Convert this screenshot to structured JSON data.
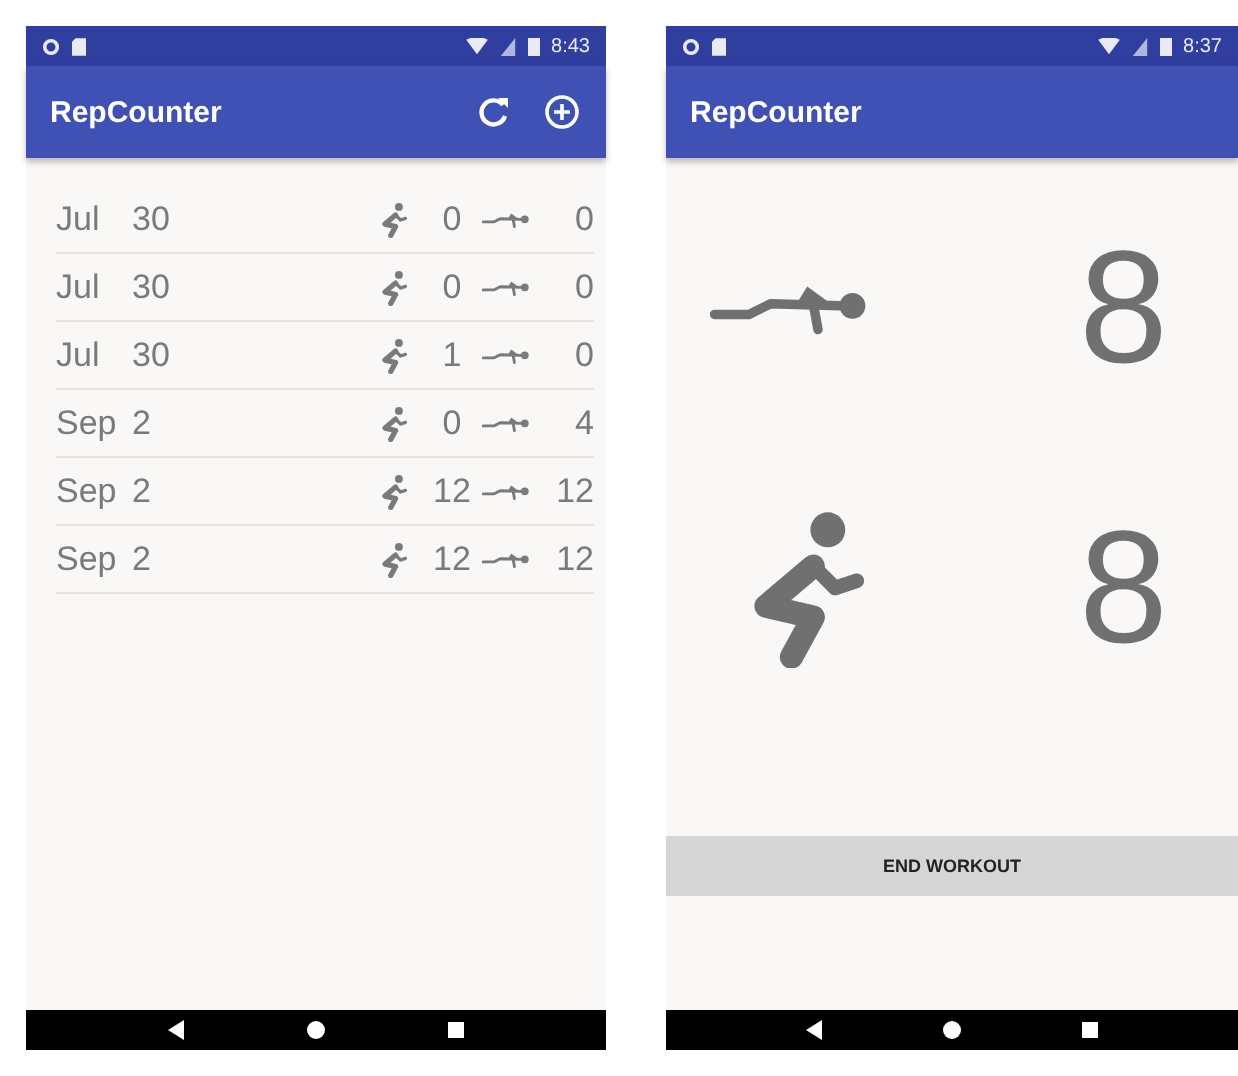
{
  "history_screen": {
    "status_bar": {
      "time": "8:43"
    },
    "app_bar": {
      "title": "RepCounter",
      "actions": [
        {
          "kind": "refresh"
        },
        {
          "kind": "add"
        }
      ]
    },
    "workouts": [
      {
        "month": "Jul",
        "day": "30",
        "squats": "0",
        "pushups": "0"
      },
      {
        "month": "Jul",
        "day": "30",
        "squats": "0",
        "pushups": "0"
      },
      {
        "month": "Jul",
        "day": "30",
        "squats": "1",
        "pushups": "0"
      },
      {
        "month": "Sep",
        "day": "2",
        "squats": "0",
        "pushups": "4"
      },
      {
        "month": "Sep",
        "day": "2",
        "squats": "12",
        "pushups": "12"
      },
      {
        "month": "Sep",
        "day": "2",
        "squats": "12",
        "pushups": "12"
      }
    ]
  },
  "workout_screen": {
    "status_bar": {
      "time": "8:37"
    },
    "app_bar": {
      "title": "RepCounter"
    },
    "counters": [
      {
        "kind": "pushup",
        "count": "8"
      },
      {
        "kind": "squat",
        "count": "8"
      }
    ],
    "button": "END WORKOUT"
  }
}
